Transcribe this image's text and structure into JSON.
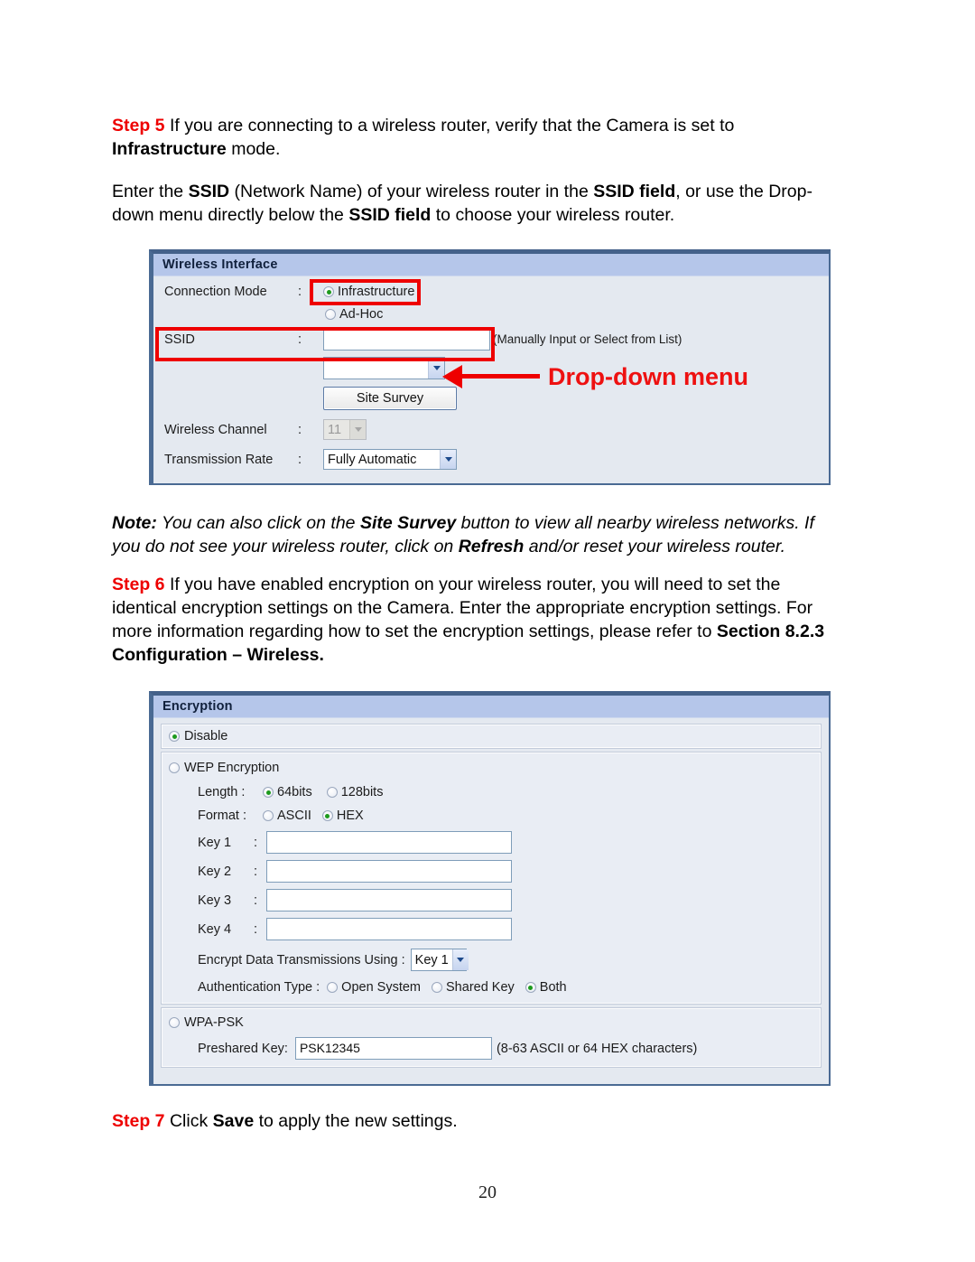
{
  "document": {
    "page_number": "20",
    "step5": {
      "label": "Step 5",
      "line1_a": " If you are connecting to a wireless router, verify that the Camera is set to ",
      "line1_bold": "Infrastructure",
      "line1_b": " mode."
    },
    "para_ssid": {
      "a": "Enter the ",
      "b1": "SSID",
      "b": " (Network Name) of your wireless router in the ",
      "b2": "SSID field",
      "c": ", or use the Drop-down menu directly below the ",
      "b3": "SSID field",
      "d": " to choose your wireless router."
    },
    "note": {
      "label": "Note:",
      "a": " You can also click on the ",
      "b1": "Site Survey",
      "b": " button to view all nearby wireless networks. If you do not see your wireless router, click on ",
      "b2": "Refresh",
      "c": " and/or reset your wireless router."
    },
    "step6": {
      "label": "Step 6",
      "a": " If you have enabled encryption on your wireless router, you will need to set the identical encryption settings on the Camera. Enter the appropriate encryption settings. For more information regarding how to set the encryption settings, please refer to ",
      "bold": "Section 8.2.3 Configuration – Wireless",
      "b": "."
    },
    "step7": {
      "label": "Step 7",
      "a": " Click ",
      "bold": "Save",
      "b": " to apply the new settings."
    }
  },
  "wireless_panel": {
    "title": "Wireless Interface",
    "connection_mode": {
      "label": "Connection Mode",
      "colon": ":",
      "options": [
        {
          "label": "Infrastructure",
          "selected": true
        },
        {
          "label": "Ad-Hoc",
          "selected": false
        }
      ]
    },
    "ssid": {
      "label": "SSID",
      "colon": ":",
      "value": "",
      "hint": "(Manually Input or Select from List)"
    },
    "ssid_dropdown": {
      "value": ""
    },
    "site_survey_button": "Site Survey",
    "wireless_channel": {
      "label": "Wireless Channel",
      "colon": ":",
      "value": "11",
      "disabled": true
    },
    "transmission_rate": {
      "label": "Transmission Rate",
      "colon": ":",
      "value": "Fully Automatic"
    },
    "annotation": {
      "dropdown_menu_label": "Drop-down menu"
    }
  },
  "encryption_panel": {
    "title": "Encryption",
    "disable": {
      "label": "Disable",
      "selected": true
    },
    "wep": {
      "label": "WEP Encryption",
      "selected": false,
      "length": {
        "label": "Length :",
        "options": [
          {
            "label": "64bits",
            "selected": true
          },
          {
            "label": "128bits",
            "selected": false
          }
        ]
      },
      "format": {
        "label": "Format :",
        "options": [
          {
            "label": "ASCII",
            "selected": false
          },
          {
            "label": "HEX",
            "selected": true
          }
        ]
      },
      "keys": [
        {
          "label": "Key 1",
          "colon": ":",
          "value": ""
        },
        {
          "label": "Key 2",
          "colon": ":",
          "value": ""
        },
        {
          "label": "Key 3",
          "colon": ":",
          "value": ""
        },
        {
          "label": "Key 4",
          "colon": ":",
          "value": ""
        }
      ],
      "encrypt_using": {
        "label": "Encrypt Data Transmissions Using :",
        "value": "Key 1"
      },
      "auth_type": {
        "label": "Authentication Type :",
        "options": [
          {
            "label": "Open System",
            "selected": false
          },
          {
            "label": "Shared Key",
            "selected": false
          },
          {
            "label": "Both",
            "selected": true
          }
        ]
      }
    },
    "wpa_psk": {
      "label": "WPA-PSK",
      "selected": false,
      "preshared_key": {
        "label": "Preshared Key:",
        "value": "PSK12345",
        "hint": "(8-63 ASCII or 64 HEX characters)"
      }
    }
  },
  "colors": {
    "accent_red": "#ee0000",
    "panel_header": "#b5c6ea",
    "panel_border": "#4a6a93",
    "panel_body": "#e4e9f0",
    "radio_on": "#1d9a1d"
  }
}
